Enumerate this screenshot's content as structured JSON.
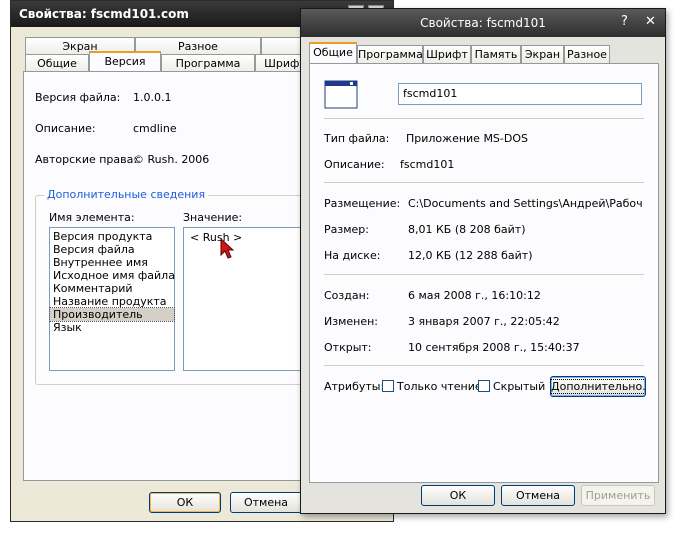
{
  "back_window": {
    "title": "Свойства: fscmd101.com",
    "tabs_row1": [
      "Экран",
      "Разное"
    ],
    "tabs_row2": [
      "Общие",
      "Версия",
      "Программа",
      "Шрифт"
    ],
    "file_version_label": "Версия файла:",
    "file_version_value": "1.0.0.1",
    "description_label": "Описание:",
    "description_value": "cmdline",
    "copyright_label": "Авторские права:",
    "copyright_value": "© Rush. 2006",
    "additional_info_legend": "Дополнительные сведения",
    "item_name_label": "Имя элемента:",
    "value_label": "Значение:",
    "items": [
      "Версия продукта",
      "Версия файла",
      "Внутреннее имя",
      "Исходное имя файла",
      "Комментарий",
      "Название продукта",
      "Производитель",
      "Язык"
    ],
    "selected_item": "Производитель",
    "value_text": "< Rush >",
    "ok_label": "ОК",
    "cancel_label": "Отмена"
  },
  "front_window": {
    "title": "Свойства: fscmd101",
    "help_glyph": "?",
    "close_glyph": "✕",
    "tabs": [
      "Общие",
      "Программа",
      "Шрифт",
      "Память",
      "Экран",
      "Разное"
    ],
    "active_tab": "Общие",
    "file_name_value": "fscmd101",
    "file_type_label": "Тип файла:",
    "file_type_value": "Приложение MS-DOS",
    "description_label": "Описание:",
    "description_value": "fscmd101",
    "location_label": "Размещение:",
    "location_value": "C:\\Documents and Settings\\Андрей\\Рабочий сто",
    "size_label": "Размер:",
    "size_value": "8,01 КБ (8 208 байт)",
    "size_on_disk_label": "На диске:",
    "size_on_disk_value": "12,0 КБ (12 288 байт)",
    "created_label": "Создан:",
    "created_value": "6 мая 2008 г., 16:10:12",
    "modified_label": "Изменен:",
    "modified_value": "3 января 2007 г., 22:05:42",
    "accessed_label": "Открыт:",
    "accessed_value": "10 сентября 2008 г., 15:40:37",
    "attributes_label": "Атрибуты:",
    "readonly_label": "Только чтение",
    "readonly_checked": false,
    "hidden_label": "Скрытый",
    "hidden_checked": false,
    "advanced_label": "Дополнительно...",
    "ok_label": "ОК",
    "cancel_label": "Отмена",
    "apply_label": "Применить"
  }
}
